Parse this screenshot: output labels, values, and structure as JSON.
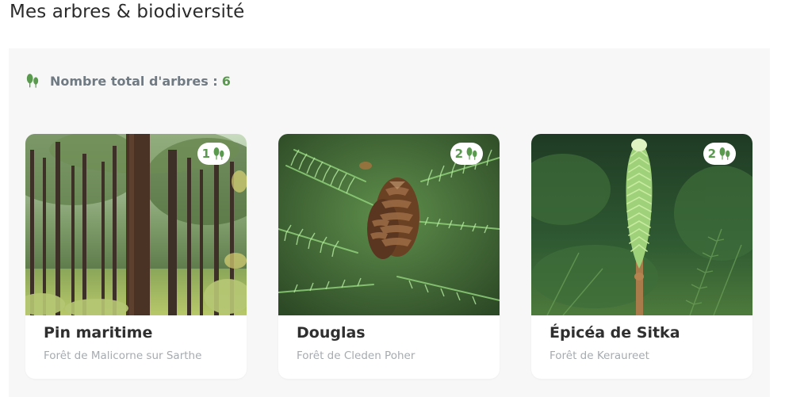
{
  "page": {
    "title": "Mes arbres & biodiversité"
  },
  "summary": {
    "label": "Nombre total d'arbres :",
    "value": "6",
    "icon": "trees-icon"
  },
  "trees": [
    {
      "name": "Pin maritime",
      "forest": "Forêt de Malicorne sur Sarthe",
      "count": "1",
      "image": "pine-forest-photo"
    },
    {
      "name": "Douglas",
      "forest": "Forêt de Cleden Poher",
      "count": "2",
      "image": "douglas-cone-photo"
    },
    {
      "name": "Épicéa de Sitka",
      "forest": "Forêt de Keraureet",
      "count": "2",
      "image": "sitka-spruce-shoot-photo"
    }
  ],
  "colors": {
    "accent_green": "#5a9a4f",
    "panel_bg": "#f7f7f7",
    "muted_text": "#a6abaf"
  }
}
